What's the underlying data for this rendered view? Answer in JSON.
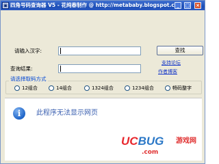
{
  "window": {
    "title": "四角号码查询器 V5 - 花纯春制作 @ http://metababy.blogspot.com",
    "minimize": "_",
    "maximize": "□",
    "close": "×"
  },
  "form": {
    "input_label": "请输入汉字:",
    "input_value": "",
    "result_label": "查询结果:",
    "result_value": "",
    "search_button": "查找",
    "support_link": "支持论坛",
    "author_link": "作者博客"
  },
  "options": {
    "group_title": "请选择取码方式",
    "items": [
      {
        "label": "12组合",
        "selected": false
      },
      {
        "label": "14组合",
        "selected": false
      },
      {
        "label": "1324组合",
        "selected": false
      },
      {
        "label": "1234组合",
        "selected": false
      },
      {
        "label": "畅码整字",
        "selected": false
      }
    ]
  },
  "browser": {
    "message": "此程序无法显示网页",
    "icon": "info-icon"
  },
  "watermark": {
    "logo_red": "UC",
    "logo_blue": "BUG",
    "cn_text": "游戏网",
    "domain": ".com"
  }
}
